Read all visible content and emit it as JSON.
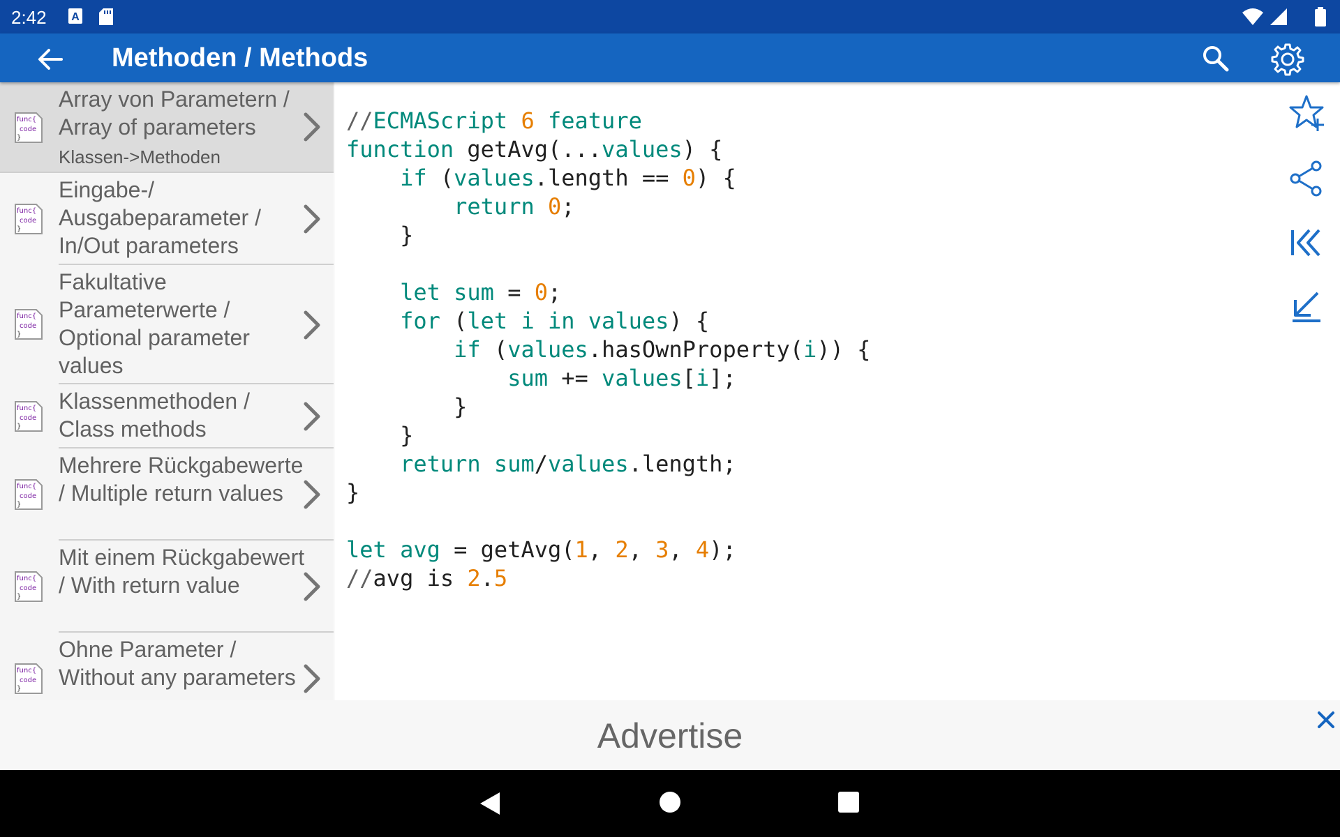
{
  "status_bar": {
    "time": "2:42"
  },
  "app_bar": {
    "title": "Methoden / Methods"
  },
  "sidebar": {
    "items": [
      {
        "label": "Array von Parametern / Array of parameters",
        "subtitle": "Klassen->Methoden",
        "icon_text": "func{ code }"
      },
      {
        "label": "Eingabe-/ Ausgabeparameter / In/Out parameters",
        "icon_text": "func{ code }"
      },
      {
        "label": "Fakultative Parameterwerte / Optional parameter values",
        "icon_text": "func{ code }"
      },
      {
        "label": "Klassenmethoden / Class methods",
        "icon_text": "func{ code }"
      },
      {
        "label": "Mehrere Rückgabewerte / Multiple return values",
        "icon_text": "func{ code }"
      },
      {
        "label": "Mit einem Rückgabewert / With return value",
        "icon_text": "func{ code }"
      },
      {
        "label": "Ohne Parameter / Without any parameters",
        "icon_text": "func{ code }"
      }
    ]
  },
  "code": {
    "lines": [
      "//ECMAScript 6 feature",
      "function getAvg(...values) {",
      "    if (values.length == 0) {",
      "        return 0;",
      "    }",
      "",
      "    let sum = 0;",
      "    for (let i in values) {",
      "        if (values.hasOwnProperty(i)) {",
      "            sum += values[i];",
      "        }",
      "    }",
      "    return sum/values.length;",
      "}",
      "",
      "let avg = getAvg(1, 2, 3, 4);",
      "//avg is 2.5"
    ]
  },
  "tools": [
    "star-add-icon",
    "share-icon",
    "first-page-icon",
    "scroll-bottom-icon"
  ],
  "ad": {
    "text": "Advertise"
  },
  "colors": {
    "status_bar": "#0d47a1",
    "app_bar": "#1565c0",
    "keyword": "#00897b",
    "number": "#e67e00",
    "tool_icon": "#1e6fc8"
  }
}
